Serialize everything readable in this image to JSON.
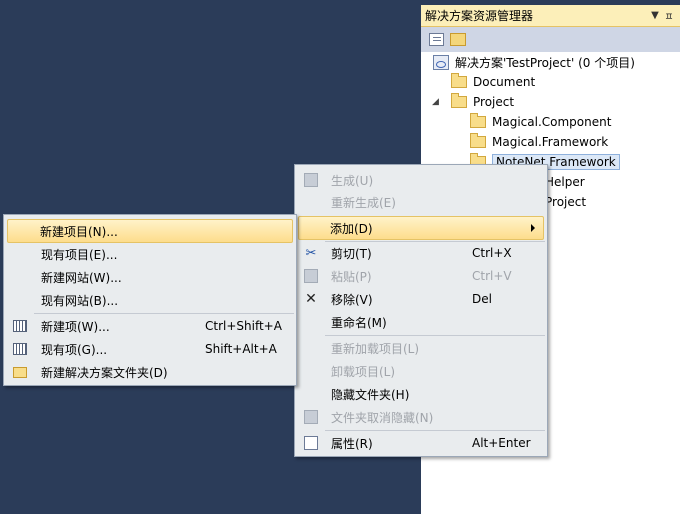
{
  "solution_explorer": {
    "title": "解决方案资源管理器",
    "dropdown_glyph": "▼",
    "pin_glyph": "ㅍ",
    "tree": {
      "solution": "解决方案'TestProject' (0 个项目)",
      "document": "Document",
      "project": "Project",
      "magical_component": "Magical.Component",
      "magical_framework": "Magical.Framework",
      "notenet_framework": "NoteNet.Framework",
      "helper_partial": "Helper",
      "project_partial": "Project"
    }
  },
  "context_menu": {
    "build": "生成(U)",
    "rebuild": "重新生成(E)",
    "add": "添加(D)",
    "cut": "剪切(T)",
    "cut_shortcut": "Ctrl+X",
    "paste": "粘贴(P)",
    "paste_shortcut": "Ctrl+V",
    "remove": "移除(V)",
    "remove_shortcut": "Del",
    "rename": "重命名(M)",
    "reload_project": "重新加载项目(L)",
    "unload_project": "卸载项目(L)",
    "hide_folder": "隐藏文件夹(H)",
    "unhide_folder": "文件夹取消隐藏(N)",
    "properties": "属性(R)",
    "properties_shortcut": "Alt+Enter"
  },
  "add_submenu": {
    "new_project": "新建项目(N)...",
    "existing_project": "现有项目(E)...",
    "new_website": "新建网站(W)...",
    "existing_website": "现有网站(B)...",
    "new_item": "新建项(W)...",
    "new_item_shortcut": "Ctrl+Shift+A",
    "existing_item": "现有项(G)...",
    "existing_item_shortcut": "Shift+Alt+A",
    "new_solution_folder": "新建解决方案文件夹(D)"
  }
}
